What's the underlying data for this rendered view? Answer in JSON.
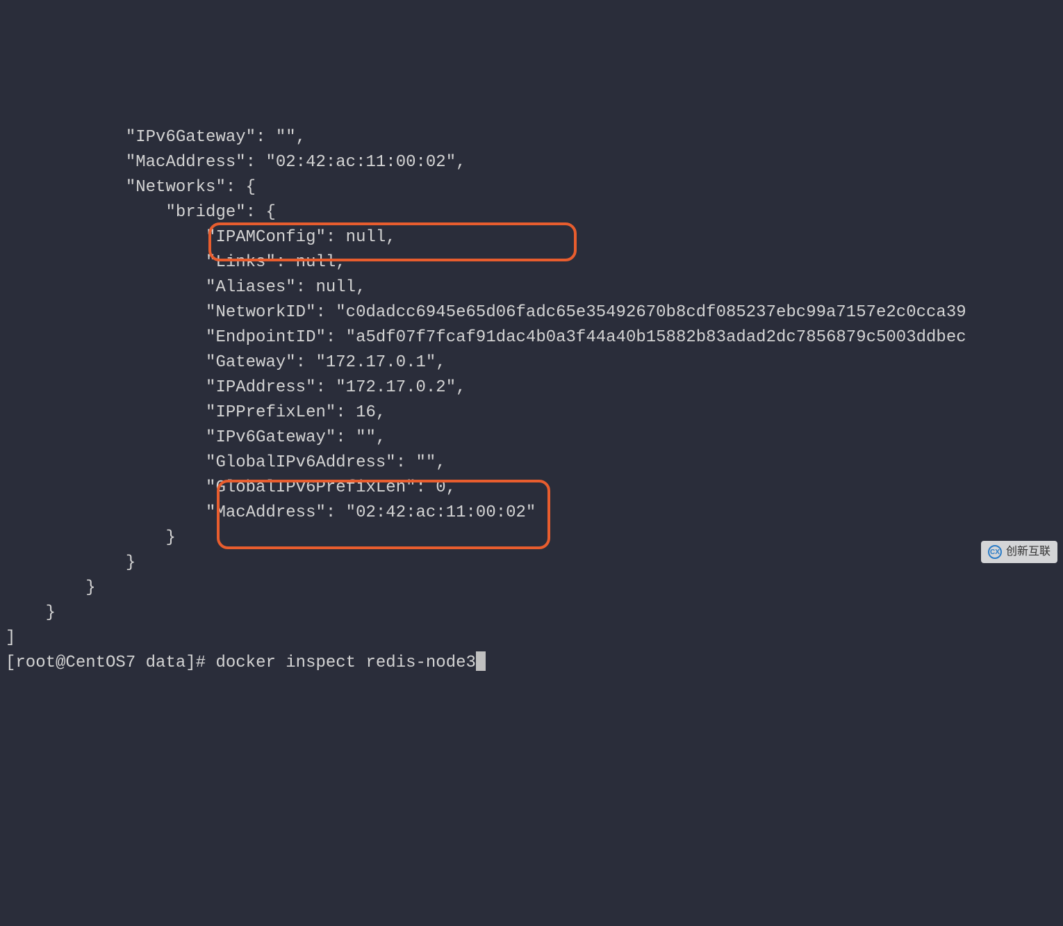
{
  "terminal": {
    "lines": [
      "            \"IPv6Gateway\": \"\",",
      "            \"MacAddress\": \"02:42:ac:11:00:02\",",
      "            \"Networks\": {",
      "                \"bridge\": {",
      "                    \"IPAMConfig\": null,",
      "                    \"Links\": null,",
      "                    \"Aliases\": null,",
      "                    \"NetworkID\": \"c0dadcc6945e65d06fadc65e35492670b8cdf085237ebc99a7157e2c0cca39",
      "                    \"EndpointID\": \"a5df07f7fcaf91dac4b0a3f44a40b15882b83adad2dc7856879c5003ddbec",
      "                    \"Gateway\": \"172.17.0.1\",",
      "                    \"IPAddress\": \"172.17.0.2\",",
      "                    \"IPPrefixLen\": 16,",
      "                    \"IPv6Gateway\": \"\",",
      "                    \"GlobalIPv6Address\": \"\",",
      "                    \"GlobalIPv6PrefixLen\": 0,",
      "                    \"MacAddress\": \"02:42:ac:11:00:02\"",
      "                }",
      "            }",
      "        }",
      "    }",
      "]"
    ],
    "prompt": "[root@CentOS7 data]# ",
    "command": "docker inspect redis-node3"
  },
  "watermark": {
    "text": "创新互联"
  }
}
